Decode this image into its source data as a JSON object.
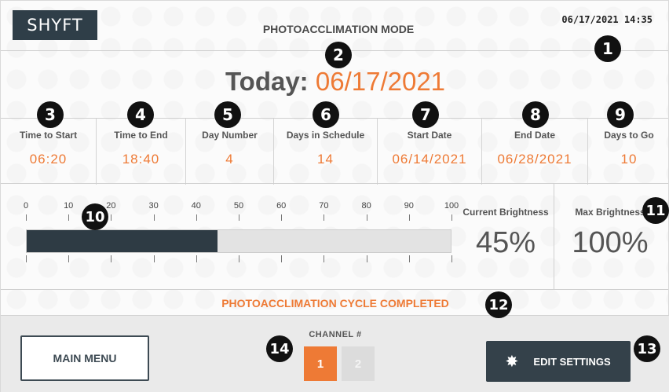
{
  "header": {
    "logo": "SHYFT",
    "mode_title": "PHOTOACCLIMATION MODE",
    "datetime": "06/17/2021  14:35"
  },
  "today": {
    "label": "Today:",
    "date": "06/17/2021"
  },
  "info": [
    {
      "label": "Time to Start",
      "value": "06:20"
    },
    {
      "label": "Time to End",
      "value": "18:40"
    },
    {
      "label": "Day Number",
      "value": "4"
    },
    {
      "label": "Days in Schedule",
      "value": "14"
    },
    {
      "label": "Start Date",
      "value": "06/14/2021"
    },
    {
      "label": "End Date",
      "value": "06/28/2021"
    },
    {
      "label": "Days to Go",
      "value": "10"
    }
  ],
  "brightness": {
    "scale": [
      "0",
      "10",
      "20",
      "30",
      "40",
      "50",
      "60",
      "70",
      "80",
      "90",
      "100"
    ],
    "current_fraction": 0.45,
    "current_label": "Current Brightness",
    "current_value": "45%",
    "max_label": "Max Brightness",
    "max_value": "100%"
  },
  "status": "PHOTOACCLIMATION CYCLE COMPLETED",
  "footer": {
    "main_menu": "MAIN MENU",
    "channel_label": "CHANNEL #",
    "channels": [
      "1",
      "2"
    ],
    "edit_settings": "EDIT SETTINGS",
    "edit_icon": "gear-icon"
  },
  "callouts": [
    "1",
    "2",
    "3",
    "4",
    "5",
    "6",
    "7",
    "8",
    "9",
    "10",
    "11",
    "12",
    "13",
    "14"
  ],
  "colors": {
    "accent": "#ee7a35",
    "dark": "#2e3b44"
  }
}
